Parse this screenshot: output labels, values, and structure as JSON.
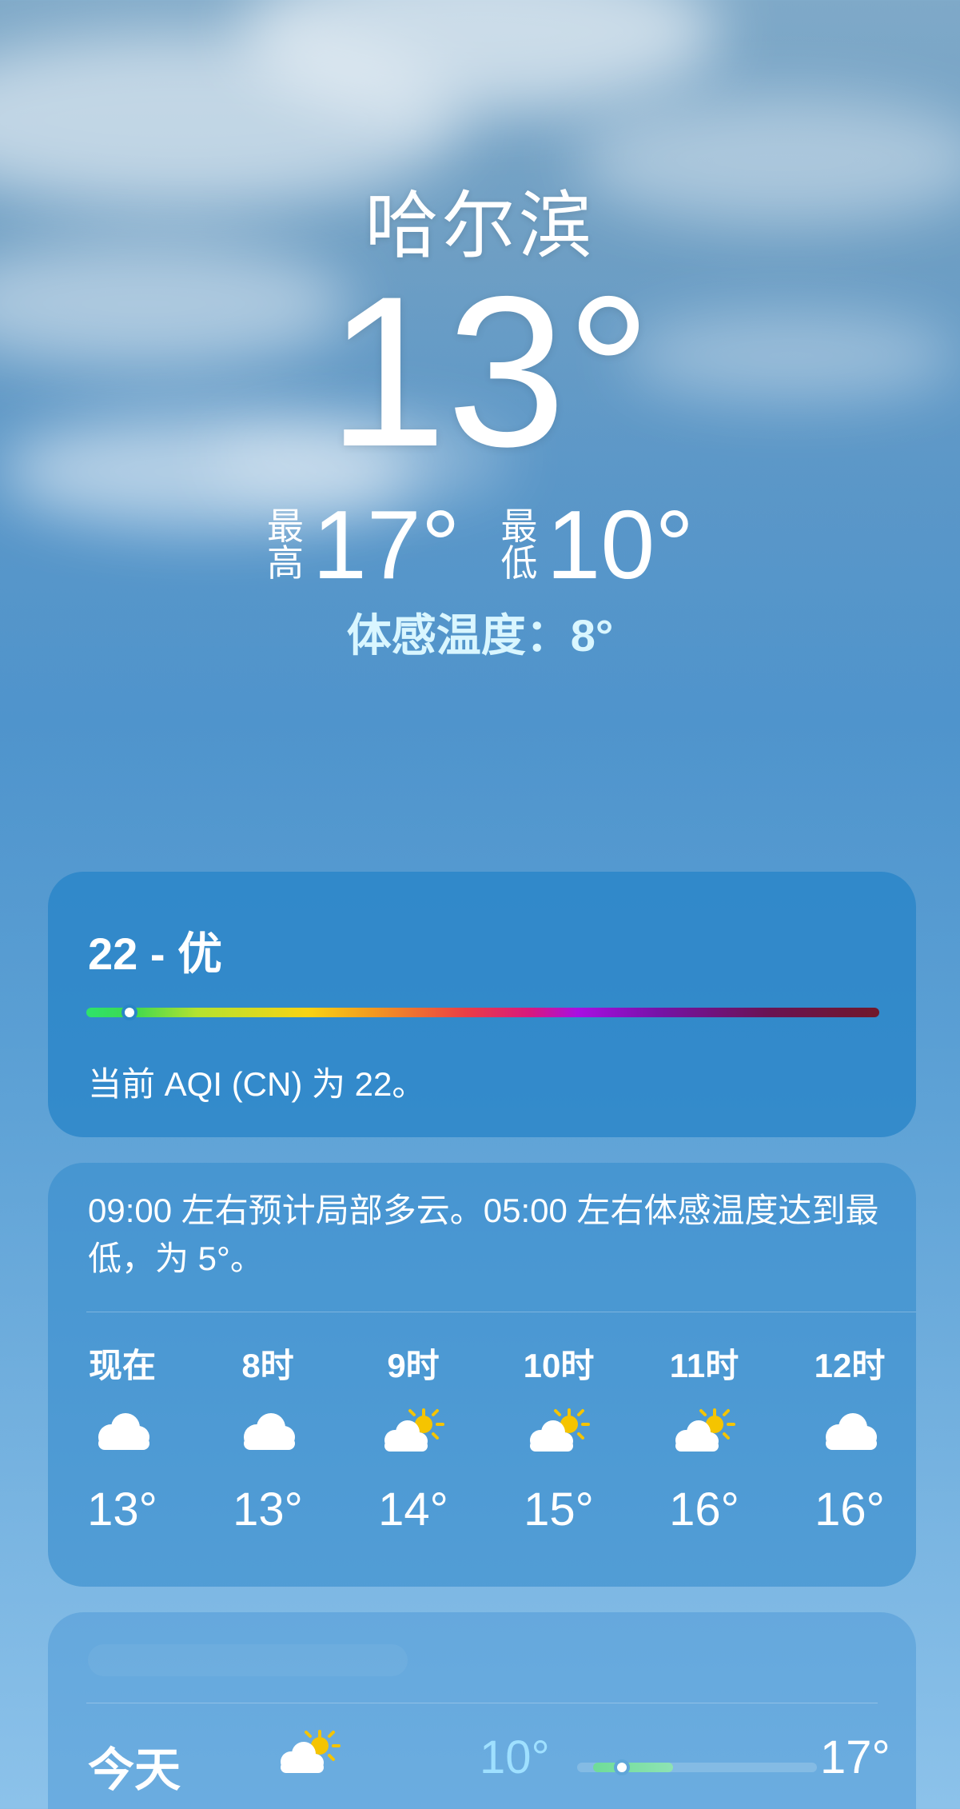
{
  "location": {
    "city": "哈尔滨"
  },
  "current": {
    "temperature": "13°",
    "high_label": "最高",
    "high": "17°",
    "low_label": "最低",
    "low": "10°",
    "feels_like": "体感温度：8°"
  },
  "aqi": {
    "title": "22 - 优",
    "value": 22,
    "scale_max": 500,
    "description": "当前 AQI (CN) 为 22。"
  },
  "hourly": {
    "summary": "09:00 左右预计局部多云。05:00 左右体感温度达到最低，为 5°。",
    "items": [
      {
        "time": "现在",
        "icon": "cloud-icon",
        "temp": "13°"
      },
      {
        "time": "8时",
        "icon": "cloud-icon",
        "temp": "13°"
      },
      {
        "time": "9时",
        "icon": "partly-sunny-icon",
        "temp": "14°"
      },
      {
        "time": "10时",
        "icon": "partly-sunny-icon",
        "temp": "15°"
      },
      {
        "time": "11时",
        "icon": "partly-sunny-icon",
        "temp": "16°"
      },
      {
        "time": "12时",
        "icon": "cloud-icon",
        "temp": "16°"
      }
    ]
  },
  "daily": {
    "items": [
      {
        "day": "今天",
        "icon": "partly-sunny-icon",
        "low": "10°",
        "high": "17°"
      }
    ]
  },
  "colors": {
    "feels_like": "#d9f6ff",
    "daily_low": "#9fe0ff",
    "sun": "#f5c400"
  }
}
